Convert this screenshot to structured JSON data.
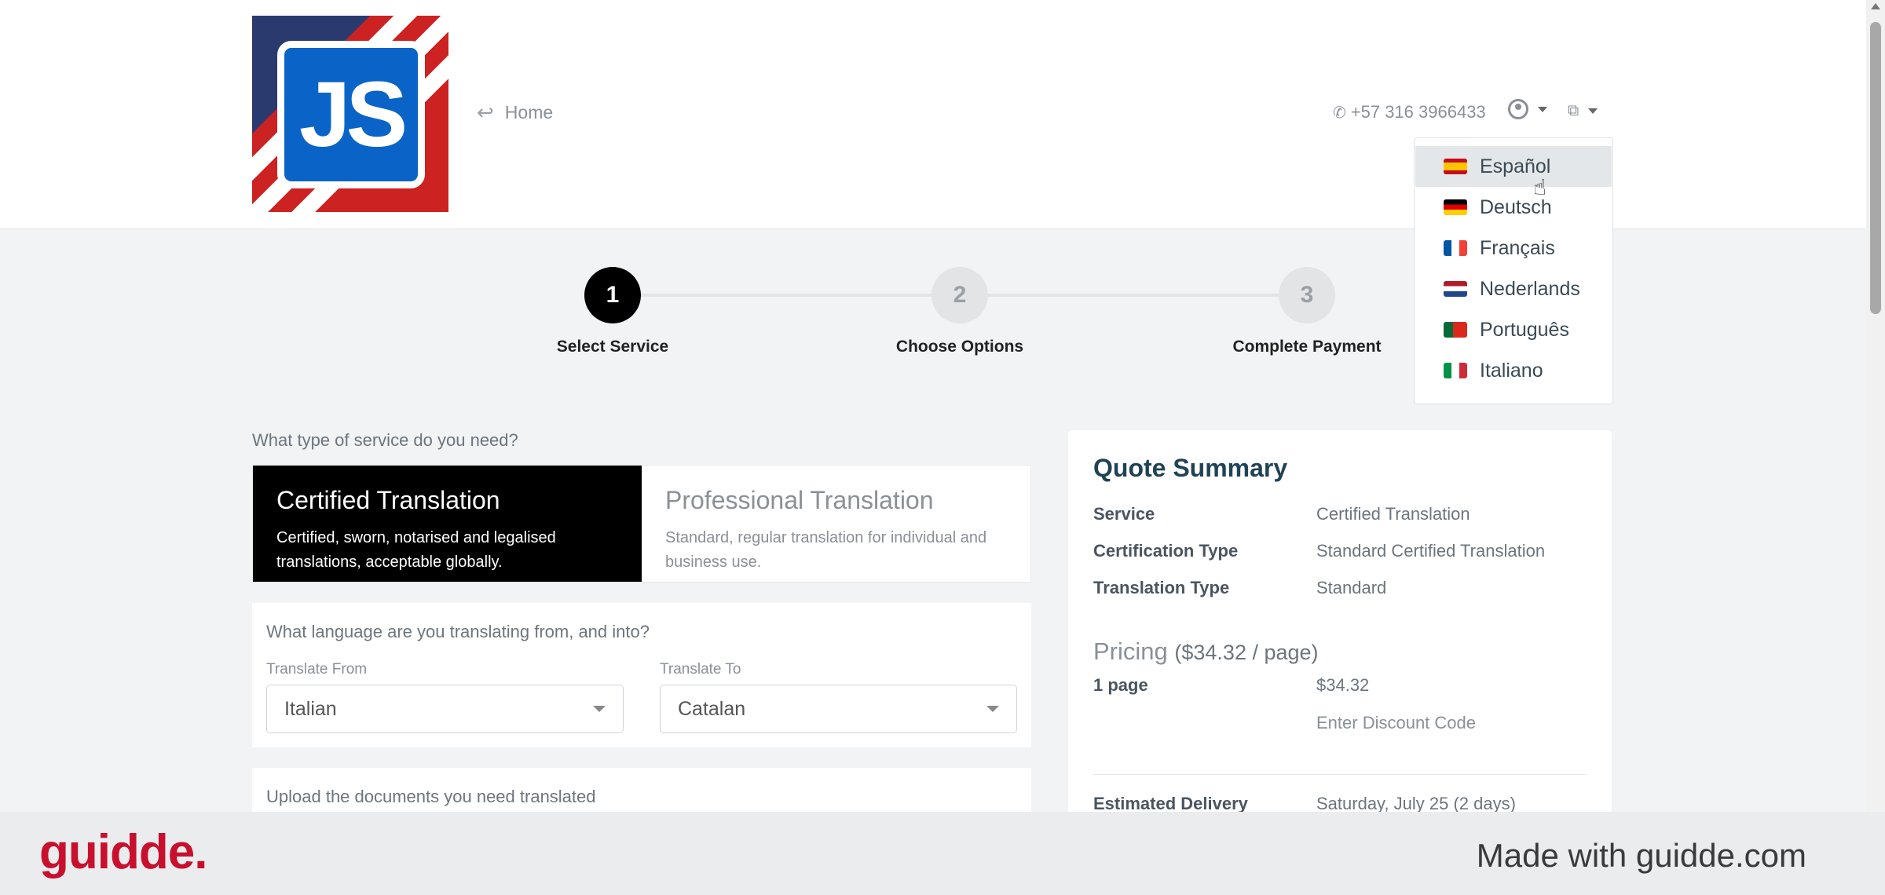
{
  "header": {
    "logo_text": "JS",
    "home_label": "Home",
    "phone": "+57 316 3966433"
  },
  "language_dropdown": {
    "items": [
      {
        "label": "Español",
        "flag": "es",
        "active": true
      },
      {
        "label": "Deutsch",
        "flag": "de"
      },
      {
        "label": "Français",
        "flag": "fr"
      },
      {
        "label": "Nederlands",
        "flag": "nl"
      },
      {
        "label": "Português",
        "flag": "pt"
      },
      {
        "label": "Italiano",
        "flag": "it"
      }
    ]
  },
  "stepper": {
    "steps": [
      {
        "number": "1",
        "label": "Select Service",
        "state": "current"
      },
      {
        "number": "2",
        "label": "Choose Options",
        "state": "todo"
      },
      {
        "number": "3",
        "label": "Complete Payment",
        "state": "todo"
      }
    ]
  },
  "service": {
    "question": "What type of service do you need?",
    "options": [
      {
        "title": "Certified Translation",
        "description": "Certified, sworn, notarised and legalised translations, acceptable globally."
      },
      {
        "title": "Professional Translation",
        "description": "Standard, regular translation for individual and business use."
      }
    ]
  },
  "languages": {
    "question": "What language are you translating from, and into?",
    "from_label": "Translate From",
    "from_value": "Italian",
    "to_label": "Translate To",
    "to_value": "Catalan"
  },
  "upload": {
    "question": "Upload the documents you need translated"
  },
  "quote": {
    "title": "Quote Summary",
    "rows": [
      {
        "key": "Service",
        "value": "Certified Translation"
      },
      {
        "key": "Certification Type",
        "value": "Standard Certified Translation"
      },
      {
        "key": "Translation Type",
        "value": "Standard"
      }
    ],
    "pricing_label": "Pricing",
    "per_page": "($34.32 / page)",
    "pages_label": "1 page",
    "pages_price": "$34.32",
    "discount_placeholder": "Enter Discount Code",
    "delivery_label": "Estimated Delivery",
    "delivery_value": "Saturday, July 25 (2 days)"
  },
  "footer": {
    "brand": "guidde.",
    "made_with": "Made with guidde.com"
  }
}
